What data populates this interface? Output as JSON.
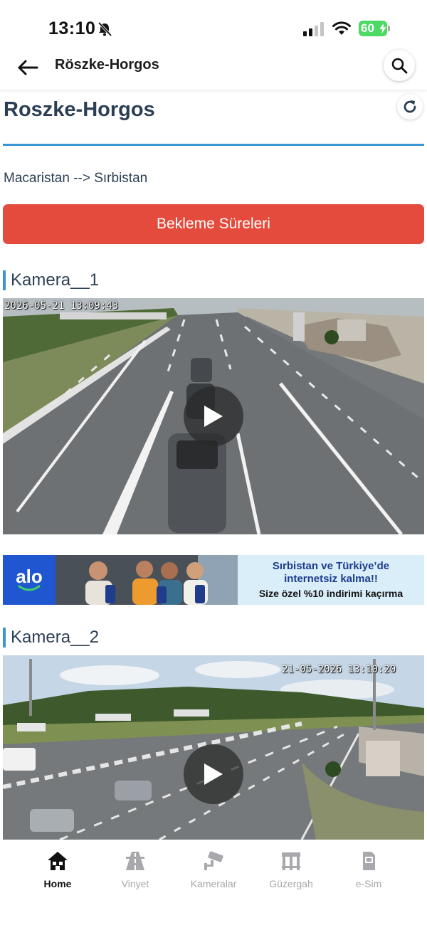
{
  "status_bar": {
    "time": "13:10",
    "battery": "60"
  },
  "header": {
    "title": "Röszke-Horgos"
  },
  "main": {
    "page_title": "Roszke-Horgos",
    "direction": "Macaristan --> Sırbistan",
    "wait_times_button": "Bekleme Süreleri",
    "cameras": [
      {
        "label": "Kamera__1",
        "timestamp": "2026-05-21 13:09:43"
      },
      {
        "label": "Kamera__2",
        "timestamp": "21-05-2026 13:10:20"
      }
    ]
  },
  "ad": {
    "logo": "alo",
    "line1": "Sırbistan ve Türkiye’de",
    "line2": "internetsiz kalma!!",
    "line3": "Size özel %10 indirimi kaçırma"
  },
  "bottom_nav": {
    "items": [
      {
        "label": "Home",
        "icon": "home-icon",
        "active": true
      },
      {
        "label": "Vinyet",
        "icon": "highway-icon",
        "active": false
      },
      {
        "label": "Kameralar",
        "icon": "cctv-camera-icon",
        "active": false
      },
      {
        "label": "Güzergah",
        "icon": "border-gate-icon",
        "active": false
      },
      {
        "label": "e-Sim",
        "icon": "sim-card-icon",
        "active": false
      }
    ]
  },
  "colors": {
    "accent_blue": "#3b94d4",
    "button_red": "#e54b3c",
    "title_navy": "#2c3e55",
    "battery_green": "#4cd964"
  }
}
